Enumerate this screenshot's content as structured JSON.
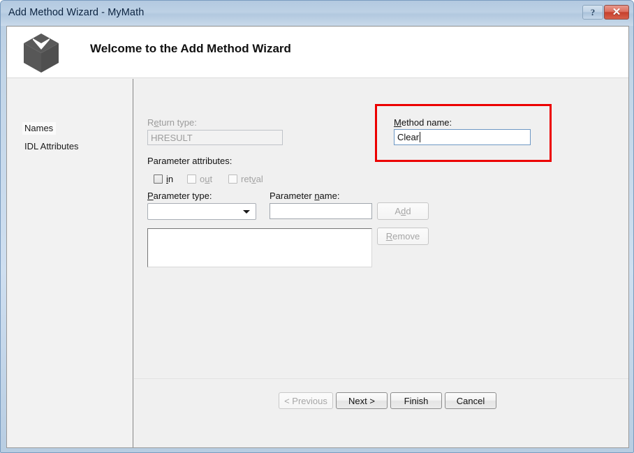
{
  "window": {
    "title": "Add Method Wizard - MyMath",
    "help_button_glyph": "?",
    "close_button_glyph": "✕"
  },
  "banner": {
    "title": "Welcome to the Add Method Wizard",
    "icon": "cube-icon"
  },
  "sidebar": {
    "items": [
      {
        "label": "Names",
        "selected": true
      },
      {
        "label": "IDL Attributes",
        "selected": false
      }
    ]
  },
  "form": {
    "return_type": {
      "label": "Return type:",
      "accelerator": "e",
      "value": "HRESULT",
      "enabled": false
    },
    "parameter_attributes": {
      "label": "Parameter attributes:",
      "checkboxes": [
        {
          "label": "in",
          "accelerator": "i",
          "checked": false,
          "enabled": true
        },
        {
          "label": "out",
          "accelerator": "u",
          "checked": false,
          "enabled": false
        },
        {
          "label": "retval",
          "accelerator": "v",
          "checked": false,
          "enabled": false
        }
      ]
    },
    "parameter_type": {
      "label": "Parameter type:",
      "accelerator": "P",
      "value": "",
      "options": []
    },
    "parameter_name": {
      "label": "Parameter name:",
      "accelerator": "n",
      "value": "",
      "placeholder": ""
    },
    "parameter_list": {
      "items": []
    },
    "add_button": {
      "label": "Add",
      "enabled": false
    },
    "remove_button": {
      "label": "Remove",
      "enabled": false
    },
    "method_name": {
      "label": "Method name:",
      "accelerator": "M",
      "value": "Clear",
      "placeholder": "",
      "focused": true
    }
  },
  "footer": {
    "previous_button": {
      "label": "< Previous",
      "enabled": false
    },
    "next_button": {
      "label": "Next >",
      "enabled": true
    },
    "finish_button": {
      "label": "Finish",
      "enabled": true
    },
    "cancel_button": {
      "label": "Cancel",
      "enabled": true
    }
  },
  "annotation": {
    "type": "highlight-rectangle",
    "color": "#ec0000",
    "target": "method-name-group"
  }
}
